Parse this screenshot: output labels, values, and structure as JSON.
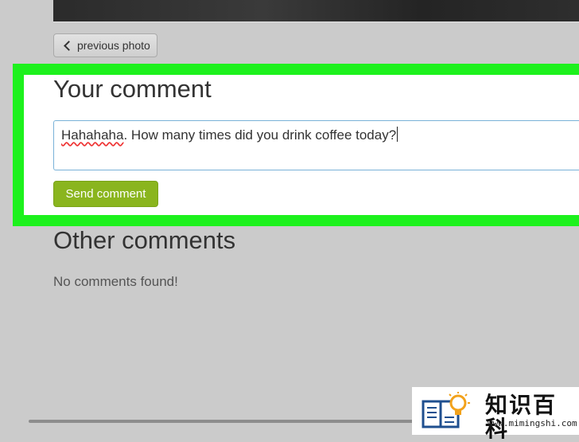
{
  "navigation": {
    "previous_label": "previous photo",
    "previous_icon": "chevron-left-icon"
  },
  "comment_form": {
    "title": "Your comment",
    "input_misspelled_word": "Hahahaha",
    "input_rest": ". How many times did you drink coffee today?",
    "send_label": "Send comment",
    "send_color": "#8ab51e",
    "highlight_color": "#1df11d"
  },
  "other_comments": {
    "title": "Other comments",
    "empty_message": "No comments found!"
  },
  "watermark": {
    "title": "知识百科",
    "url": "www.mimingshi.com",
    "icon": "book-lightbulb-icon"
  }
}
